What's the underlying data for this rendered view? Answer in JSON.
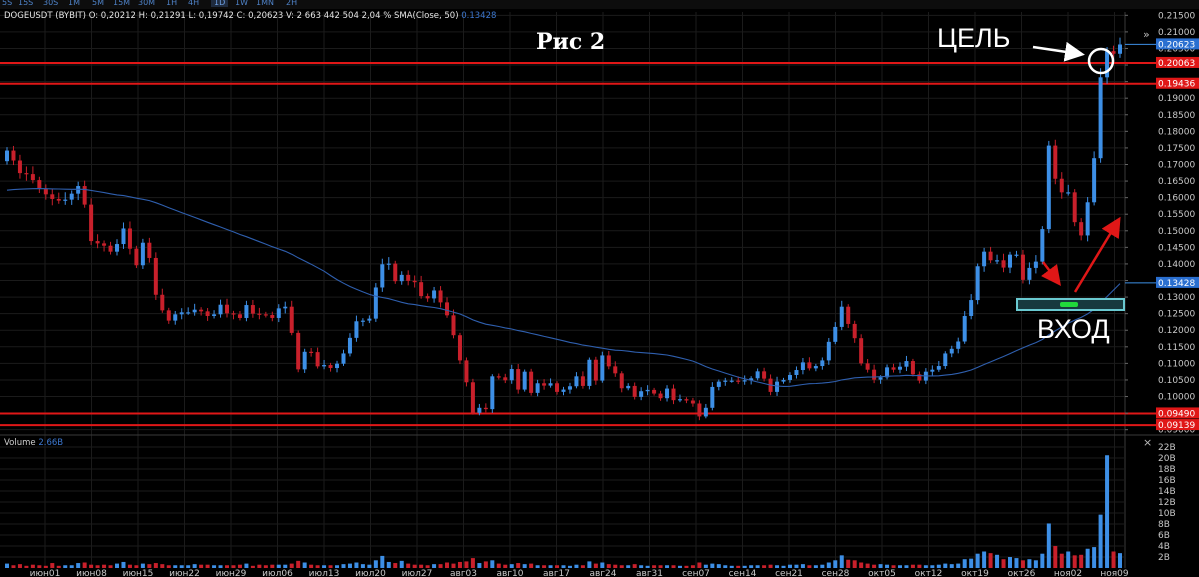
{
  "toolbar": {
    "timeframes": [
      "5S",
      "15S",
      "30S",
      "1M",
      "5M",
      "15M",
      "30M",
      "1H",
      "4H",
      "1D",
      "1W",
      "1MN",
      "2H"
    ],
    "active": "1D"
  },
  "legend": {
    "symbol": "DOGEUSDT (BYBIT)",
    "o": "O: 0,20212",
    "h": "H: 0,21291",
    "l": "L: 0,19742",
    "c": "C: 0,20623",
    "v": "V: 2 663 442 504",
    "chg": "2,04 %",
    "sma": "SMA(Close, 50)",
    "sma_val": "0.13428"
  },
  "annotations": {
    "title": "Рис 2",
    "target": "ЦЕЛЬ",
    "entry": "ВХОД"
  },
  "volume": {
    "label": "Volume",
    "value": "2.66B"
  },
  "colors": {
    "bg": "#000000",
    "up": "#3d8fe6",
    "down": "#c8202b",
    "sma": "#2f5fae",
    "level": "#e01717",
    "grid": "#1b1b1b",
    "entry_box": "#69c9d0",
    "entry_fill": "#21d93b"
  },
  "chart_data": {
    "type": "candlestick",
    "ylim": [
      0.089,
      0.216
    ],
    "y_ticks": [
      "0.21500",
      "0.21000",
      "0.20500",
      "0.20000",
      "0.19500",
      "0.19000",
      "0.18500",
      "0.18000",
      "0.17500",
      "0.17000",
      "0.16500",
      "0.16000",
      "0.15500",
      "0.15000",
      "0.14500",
      "0.14000",
      "0.13500",
      "0.13000",
      "0.12500",
      "0.12000",
      "0.11500",
      "0.11000",
      "0.10500",
      "0.10000",
      "0.09500",
      "0.09000"
    ],
    "x_labels": [
      "июн01",
      "июн08",
      "июн15",
      "июн22",
      "июн29",
      "июл06",
      "июл13",
      "июл20",
      "июл27",
      "авг03",
      "авг10",
      "авг17",
      "авг24",
      "авг31",
      "сен07",
      "сен14",
      "сен21",
      "сен28",
      "окт05",
      "окт12",
      "окт19",
      "окт26",
      "ноя02",
      "ноя09"
    ],
    "levels": [
      {
        "value": 0.20063,
        "label": "0.20063"
      },
      {
        "value": 0.19436,
        "label": "0.19436"
      },
      {
        "value": 0.0949,
        "label": "0.09490"
      },
      {
        "value": 0.09139,
        "label": "0.09139"
      }
    ],
    "price_labels": [
      {
        "value": 0.20623,
        "label": "0.20623"
      },
      {
        "value": 0.13428,
        "label": "0.13428"
      }
    ],
    "volume_ticks": [
      "22B",
      "20B",
      "18B",
      "16B",
      "14B",
      "12B",
      "10B",
      "8B",
      "6B",
      "4B",
      "2B"
    ],
    "volume_ylim": [
      0,
      22
    ],
    "close": [
      0.1742,
      0.1712,
      0.1674,
      0.1671,
      0.1653,
      0.1627,
      0.161,
      0.1596,
      0.1591,
      0.1594,
      0.1612,
      0.1635,
      0.1579,
      0.1469,
      0.1462,
      0.1455,
      0.1437,
      0.146,
      0.1507,
      0.1446,
      0.1396,
      0.1464,
      0.1418,
      0.1307,
      0.126,
      0.1229,
      0.1248,
      0.1254,
      0.1254,
      0.1262,
      0.1257,
      0.1243,
      0.1248,
      0.1277,
      0.1251,
      0.1248,
      0.1237,
      0.1276,
      0.125,
      0.1248,
      0.1246,
      0.1237,
      0.1266,
      0.1271,
      0.1192,
      0.1082,
      0.1135,
      0.1134,
      0.1091,
      0.1095,
      0.1086,
      0.1099,
      0.113,
      0.1177,
      0.1227,
      0.1229,
      0.1235,
      0.1329,
      0.1399,
      0.1401,
      0.1348,
      0.1367,
      0.1349,
      0.1345,
      0.1303,
      0.1296,
      0.132,
      0.1284,
      0.1245,
      0.1185,
      0.1109,
      0.1043,
      0.0951,
      0.0966,
      0.0962,
      0.1061,
      0.1058,
      0.1049,
      0.1083,
      0.1021,
      0.1075,
      0.1011,
      0.104,
      0.1033,
      0.104,
      0.1014,
      0.1021,
      0.1031,
      0.1061,
      0.1032,
      0.1111,
      0.1048,
      0.1124,
      0.1091,
      0.107,
      0.1025,
      0.1032,
      0.0999,
      0.1016,
      0.102,
      0.1009,
      0.0995,
      0.1024,
      0.0989,
      0.0992,
      0.0988,
      0.0979,
      0.094,
      0.0966,
      0.1029,
      0.1045,
      0.1048,
      0.1048,
      0.1046,
      0.1049,
      0.1055,
      0.1076,
      0.1054,
      0.1014,
      0.1045,
      0.105,
      0.1065,
      0.108,
      0.1103,
      0.1085,
      0.1092,
      0.1109,
      0.1165,
      0.121,
      0.1271,
      0.1219,
      0.1176,
      0.11,
      0.1081,
      0.1051,
      0.1058,
      0.1088,
      0.1081,
      0.109,
      0.1107,
      0.1067,
      0.1048,
      0.1075,
      0.1081,
      0.1092,
      0.113,
      0.1144,
      0.1166,
      0.1243,
      0.1291,
      0.1393,
      0.1437,
      0.1411,
      0.1411,
      0.1389,
      0.1428,
      0.1428,
      0.1352,
      0.1388,
      0.1407,
      0.1505,
      0.1757,
      0.1657,
      0.1616,
      0.1616,
      0.1526,
      0.1486,
      0.1586,
      0.1719,
      0.1963,
      0.2042,
      0.2034,
      0.2062
    ],
    "volume": [
      0.8,
      0.5,
      0.7,
      0.4,
      0.6,
      0.5,
      0.4,
      0.9,
      0.4,
      0.5,
      0.5,
      0.9,
      1.0,
      0.6,
      0.5,
      0.6,
      0.5,
      0.8,
      1.1,
      0.6,
      0.5,
      0.8,
      0.7,
      0.9,
      0.7,
      0.5,
      0.5,
      0.5,
      0.5,
      0.7,
      0.6,
      0.6,
      0.5,
      0.5,
      0.5,
      0.5,
      0.6,
      0.8,
      0.4,
      0.6,
      0.5,
      0.6,
      0.6,
      0.6,
      0.8,
      1.3,
      1.0,
      0.6,
      0.5,
      0.5,
      0.5,
      0.5,
      0.7,
      0.8,
      1.0,
      0.7,
      0.6,
      1.4,
      2.2,
      1.1,
      0.9,
      1.3,
      0.8,
      0.6,
      0.6,
      0.5,
      0.7,
      0.7,
      1.0,
      0.8,
      1.1,
      1.2,
      1.8,
      0.9,
      1.2,
      1.4,
      0.8,
      0.6,
      0.7,
      0.9,
      0.7,
      0.8,
      0.5,
      0.5,
      0.5,
      0.5,
      0.5,
      0.4,
      0.6,
      0.5,
      1.2,
      0.8,
      1.0,
      0.7,
      0.6,
      0.5,
      0.5,
      0.7,
      0.5,
      0.4,
      0.5,
      0.5,
      0.5,
      0.5,
      0.4,
      0.4,
      0.5,
      1.0,
      0.6,
      0.8,
      0.7,
      0.5,
      0.4,
      0.4,
      0.4,
      0.5,
      0.5,
      0.5,
      0.6,
      0.5,
      0.4,
      0.6,
      0.6,
      0.7,
      0.5,
      0.5,
      0.6,
      1.0,
      1.4,
      2.3,
      1.5,
      1.4,
      1.0,
      0.8,
      0.6,
      0.7,
      0.6,
      0.5,
      0.5,
      0.5,
      0.6,
      0.6,
      0.5,
      0.5,
      0.6,
      0.8,
      0.7,
      0.8,
      1.6,
      1.7,
      2.6,
      3.0,
      2.7,
      2.4,
      1.6,
      2.0,
      1.8,
      1.4,
      1.6,
      1.4,
      2.6,
      8.1,
      4.0,
      2.6,
      3.0,
      2.3,
      2.4,
      3.5,
      3.8,
      9.7,
      20.5,
      3.0,
      2.7
    ]
  }
}
